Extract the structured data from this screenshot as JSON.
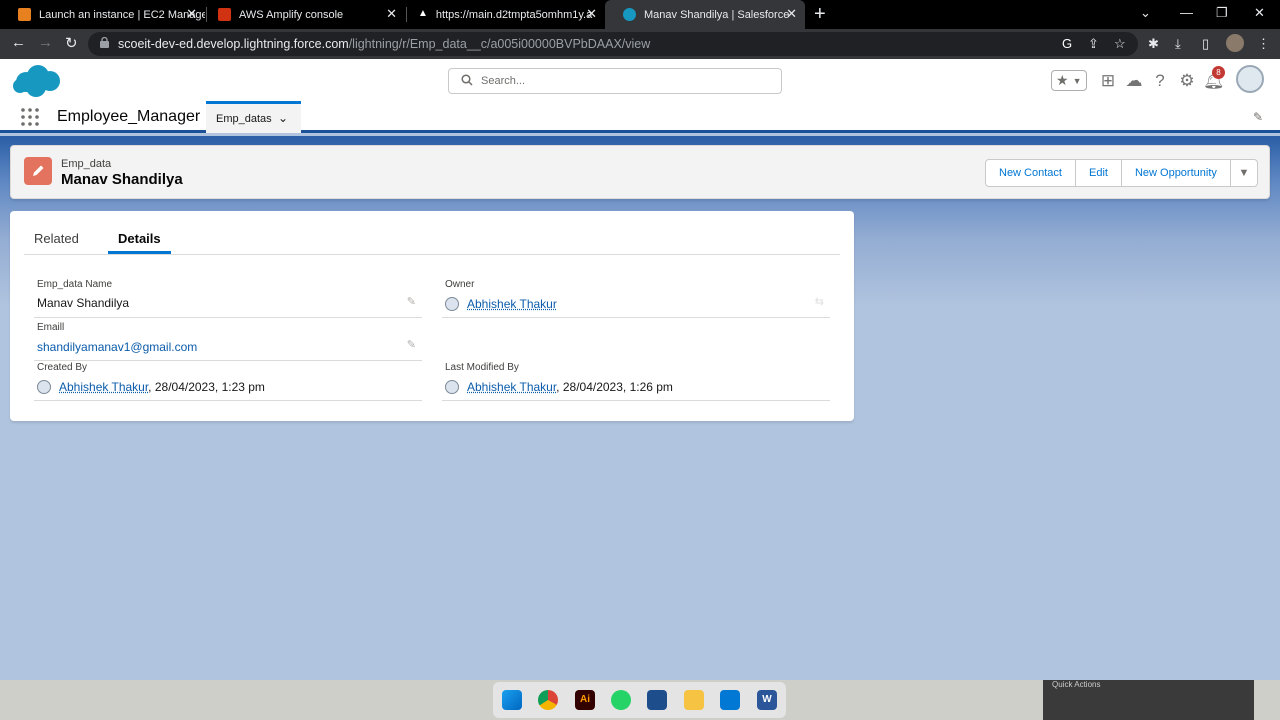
{
  "browser": {
    "tabs": [
      {
        "title": "Launch an instance | EC2 Manage",
        "favicon": "aws-ec2-icon",
        "color": "#e7811f"
      },
      {
        "title": "AWS Amplify console",
        "favicon": "aws-amplify-icon",
        "color": "#d13212"
      },
      {
        "title": "https://main.d2tmpta5omhm1y.a",
        "favicon": "amplify-app-icon",
        "color": "#ffffff"
      },
      {
        "title": "Manav Shandilya | Salesforce",
        "favicon": "salesforce-icon",
        "color": "#1798c1"
      }
    ],
    "url_host": "scoeit-dev-ed.develop.lightning.force.com",
    "url_path": "/lightning/r/Emp_data__c/a005i00000BVPbDAAX/view"
  },
  "header": {
    "search_placeholder": "Search...",
    "notification_count": "8"
  },
  "appnav": {
    "app_name": "Employee_Manager",
    "tab_label": "Emp_datas"
  },
  "record": {
    "object_label": "Emp_data",
    "title": "Manav Shandilya",
    "buttons": {
      "new_contact": "New Contact",
      "edit": "Edit",
      "new_opportunity": "New Opportunity"
    }
  },
  "card": {
    "tabs": [
      "Related",
      "Details"
    ],
    "active_tab": "Details",
    "fields": {
      "name_label": "Emp_data Name",
      "name_value": "Manav Shandilya",
      "owner_label": "Owner",
      "owner_value": "Abhishek Thakur",
      "email_label": "Emaill",
      "email_value": "shandilyamanav1@gmail.com",
      "created_label": "Created By",
      "created_user": "Abhishek Thakur",
      "created_date": ", 28/04/2023, 1:23 pm",
      "modified_label": "Last Modified By",
      "modified_user": "Abhishek Thakur",
      "modified_date": ", 28/04/2023, 1:26 pm"
    }
  },
  "taskbar": {
    "apps": [
      "windows-start-icon",
      "chrome-icon",
      "illustrator-icon",
      "whatsapp-icon",
      "virtualbox-icon",
      "file-explorer-icon",
      "vscode-icon",
      "word-icon"
    ],
    "quick_actions_label": "Quick Actions"
  },
  "colors": {
    "brand_blue": "#0176d3",
    "link_blue": "#0b5cab",
    "record_icon": "#e3735e",
    "background": "#b0c4df"
  }
}
